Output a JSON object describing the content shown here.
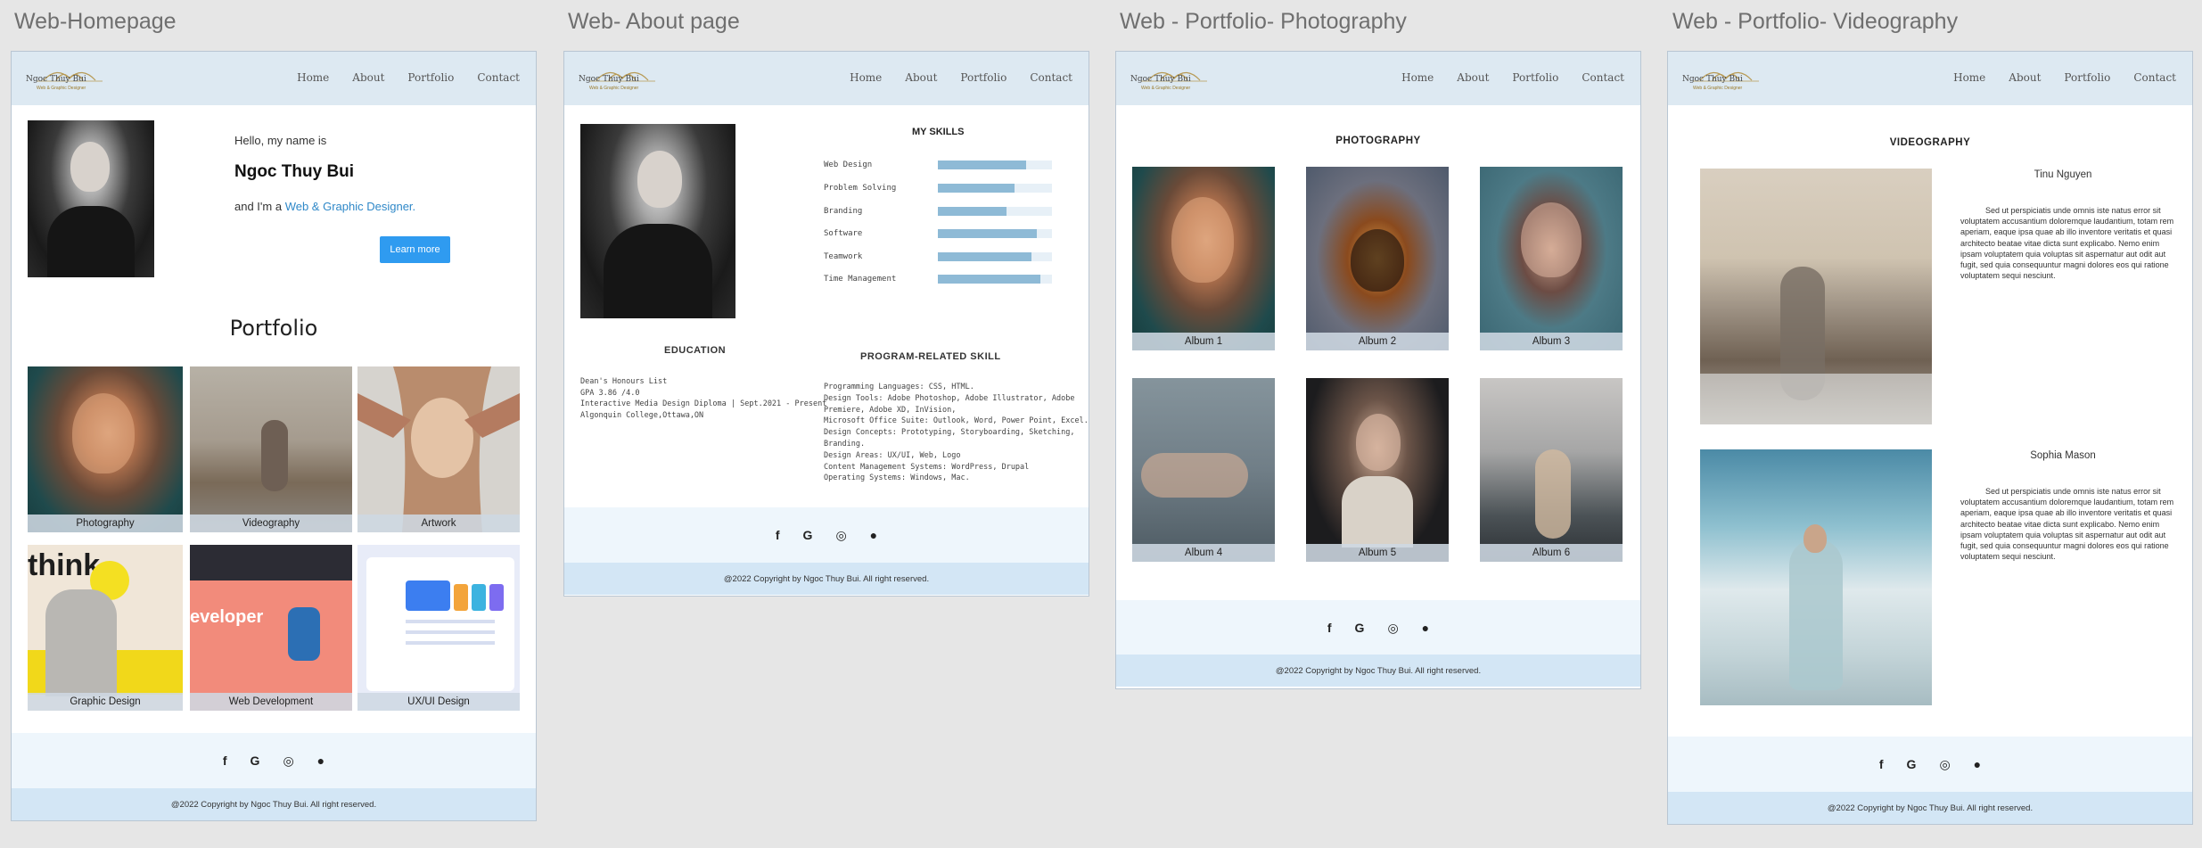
{
  "boards": [
    {
      "title": "Web-Homepage"
    },
    {
      "title": "Web- About page"
    },
    {
      "title": "Web - Portfolio- Photography"
    },
    {
      "title": "Web - Portfolio- Videography"
    }
  ],
  "brand": {
    "logo_name": "Ngoc Thuy Bui",
    "logo_sub": "Web & Graphic Designer"
  },
  "nav": {
    "home": "Home",
    "about": "About",
    "portfolio": "Portfolio",
    "contact": "Contact"
  },
  "footer": {
    "copyright": "@2022 Copyright by Ngoc Thuy Bui. All right reserved.",
    "social_icons": [
      "facebook-icon",
      "google-icon",
      "instagram-icon",
      "github-icon"
    ]
  },
  "home": {
    "greeting": "Hello, my name is",
    "name": "Ngoc Thuy Bui",
    "intro_prefix": "and I'm a",
    "role": "Web & Graphic Designer.",
    "cta": "Learn more",
    "portfolio_heading": "Portfolio",
    "tiles": [
      "Photography",
      "Videography",
      "Artwork",
      "Graphic Design",
      "Web Development",
      "UX/UI Design"
    ],
    "tile_art": {
      "think": "think",
      "developer": "eveloper"
    }
  },
  "about": {
    "skills_heading": "MY SKILLS",
    "skills": [
      {
        "label": "Web Design",
        "level": 0.77
      },
      {
        "label": "Problem Solving",
        "level": 0.67
      },
      {
        "label": "Branding",
        "level": 0.6
      },
      {
        "label": "Software",
        "level": 0.87
      },
      {
        "label": "Teamwork",
        "level": 0.82
      },
      {
        "label": "Time Management",
        "level": 0.9
      }
    ],
    "education_heading": "EDUCATION",
    "education_lines": [
      "Dean's Honours List",
      "GPA 3.86 /4.0",
      "Interactive Media Design Diploma | Sept.2021 - Present",
      "Algonquin College,Ottawa,ON"
    ],
    "program_heading": "PROGRAM-RELATED SKILL",
    "program_lines": [
      "Programming Languages: CSS, HTML.",
      "Design Tools: Adobe Photoshop, Adobe Illustrator, Adobe",
      "Premiere, Adobe XD, InVision,",
      "Microsoft Office Suite: Outlook, Word, Power Point, Excel.",
      "Design Concepts: Prototyping, Storyboarding, Sketching,",
      "Branding.",
      "Design Areas: UX/UI, Web, Logo",
      "Content Management Systems: WordPress, Drupal",
      "Operating Systems: Windows, Mac."
    ]
  },
  "photography": {
    "heading": "PHOTOGRAPHY",
    "albums": [
      "Album 1",
      "Album 2",
      "Album 3",
      "Album 4",
      "Album 5",
      "Album 6"
    ]
  },
  "videography": {
    "heading": "VIDEOGRAPHY",
    "entries": [
      {
        "name": "Tinu Nguyen",
        "text": "Sed ut perspiciatis unde omnis iste natus error sit voluptatem accusantium doloremque laudantium, totam rem aperiam, eaque ipsa quae ab illo inventore veritatis et quasi architecto beatae vitae dicta sunt explicabo. Nemo enim ipsam voluptatem quia voluptas sit aspernatur aut odit aut fugit, sed quia consequuntur magni dolores eos qui ratione voluptatem sequi nesciunt."
      },
      {
        "name": "Sophia Mason",
        "text": "Sed ut perspiciatis unde omnis iste natus error sit voluptatem accusantium doloremque laudantium, totam rem aperiam, eaque ipsa quae ab illo inventore veritatis et quasi architecto beatae vitae dicta sunt explicabo. Nemo enim ipsam voluptatem quia voluptas sit aspernatur aut odit aut fugit, sed quia consequuntur magni dolores eos qui ratione voluptatem sequi nesciunt."
      }
    ]
  }
}
